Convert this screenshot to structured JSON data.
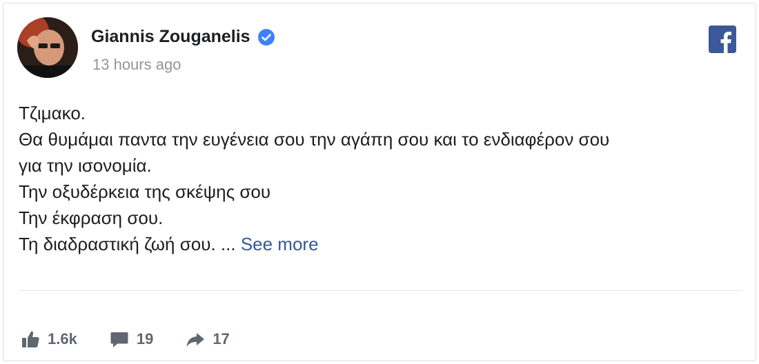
{
  "post": {
    "author": "Giannis Zouganelis",
    "verified_icon": "verified-badge-icon",
    "timestamp": "13 hours ago",
    "brand_icon": "facebook-logo-icon",
    "brand_color": "#3b5998",
    "lines": [
      "Τζιμακο.",
      "Θα θυμάμαι παντα την ευγένεια σου την αγάπη σου και το ενδιαφέρον σου",
      "για την ισονομία.",
      "Την οξυδέρκεια της σκέψης σου",
      "Την έκφραση σου."
    ],
    "last_line": "Τη διαδραστική ζωή σου. ...",
    "see_more": "See more"
  },
  "stats": {
    "likes": "1.6k",
    "comments": "19",
    "shares": "17",
    "icons": [
      "like-icon",
      "comment-icon",
      "share-icon"
    ]
  },
  "colors": {
    "link": "#365899",
    "muted": "#90949c",
    "verified": "#4080ff"
  }
}
